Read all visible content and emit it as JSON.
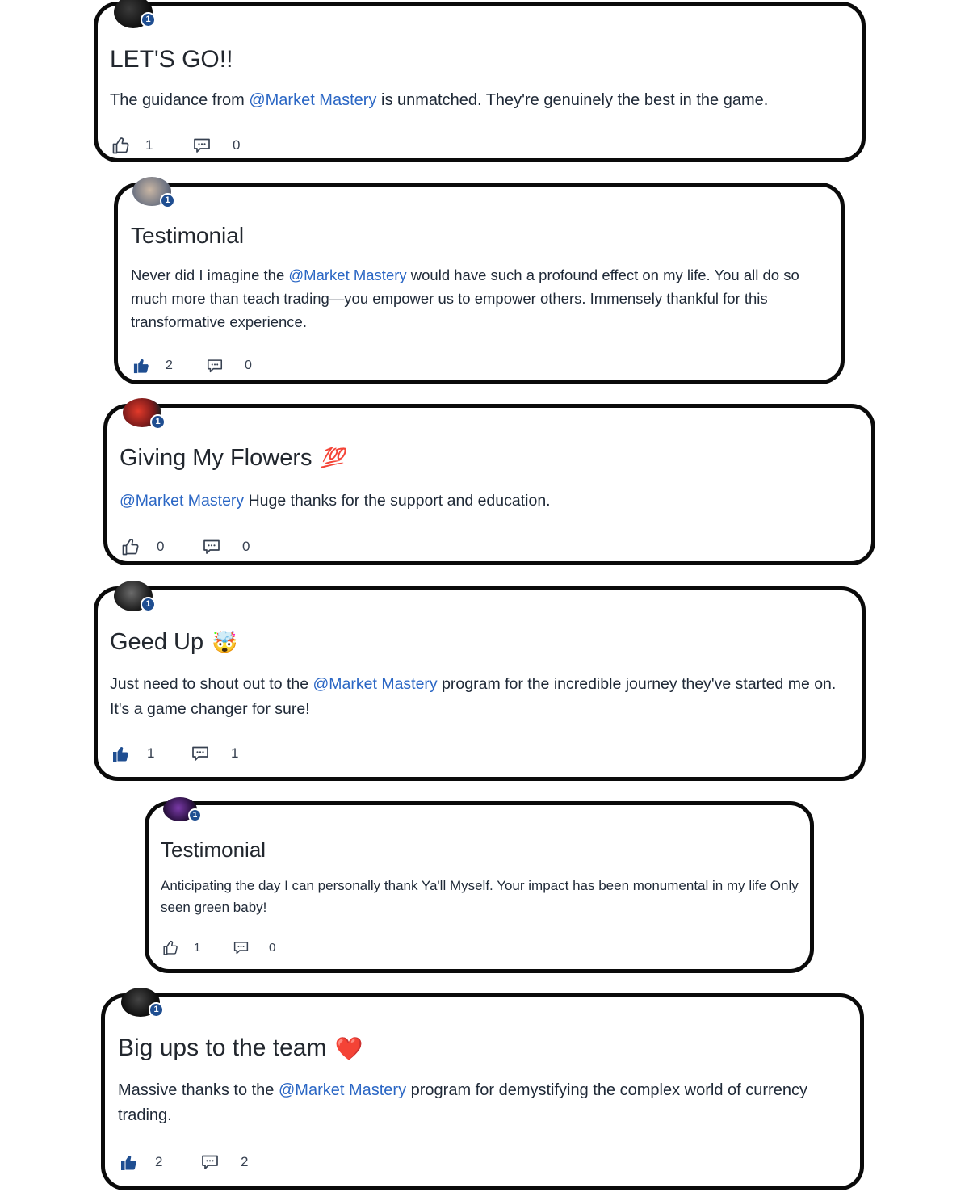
{
  "posts": [
    {
      "level": "1",
      "title": "LET'S GO!!",
      "title_emoji": "",
      "mention": "@Market Mastery",
      "body_before": "The guidance from ",
      "body_after": " is unmatched. They're genuinely the best in the game.",
      "likes": "1",
      "comments": "0",
      "liked": false
    },
    {
      "level": "1",
      "title": "Testimonial",
      "title_emoji": "",
      "mention": "@Market Mastery",
      "body_before": "Never did I imagine the ",
      "body_after": " would have such a profound effect on my life. You all do so much more than teach trading—you empower us to empower others. Immensely thankful for this transformative experience.",
      "likes": "2",
      "comments": "0",
      "liked": true
    },
    {
      "level": "1",
      "title": "Giving My Flowers",
      "title_emoji": "💯",
      "mention": "@Market Mastery",
      "body_before": "",
      "body_after": " Huge thanks for the support and education.",
      "likes": "0",
      "comments": "0",
      "liked": false
    },
    {
      "level": "1",
      "title": "Geed Up",
      "title_emoji": "🤯",
      "mention": "@Market Mastery",
      "body_before": "Just need to shout out to the ",
      "body_after": " program for the incredible journey they've started me on. It's a game changer for sure!",
      "likes": "1",
      "comments": "1",
      "liked": true
    },
    {
      "level": "1",
      "title": "Testimonial",
      "title_emoji": "",
      "mention": "",
      "body_before": "Anticipating the day I can personally thank Ya'll Myself. Your impact has been monumental in my life Only seen green baby!",
      "body_after": "",
      "likes": "1",
      "comments": "0",
      "liked": false
    },
    {
      "level": "1",
      "title": "Big ups to the team",
      "title_emoji": "❤️",
      "mention": "@Market Mastery",
      "body_before": "Massive thanks to the ",
      "body_after": " program for demystifying the complex world of currency trading.",
      "likes": "2",
      "comments": "2",
      "liked": true
    }
  ],
  "colors": {
    "accent_link": "#2a66c4",
    "level_badge": "#1f4e91",
    "liked_thumb": "#1f4e91",
    "card_border": "#0a0a0a"
  },
  "icons": {
    "like": "thumbs-up-icon",
    "comment": "comment-bubble-icon"
  }
}
